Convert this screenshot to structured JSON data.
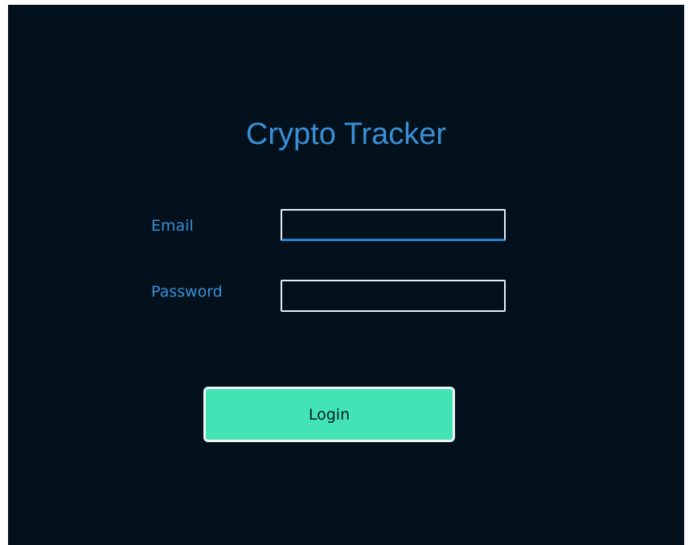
{
  "app": {
    "title": "Crypto Tracker"
  },
  "form": {
    "email_label": "Email",
    "email_value": "",
    "password_label": "Password",
    "password_value": "",
    "login_label": "Login"
  },
  "colors": {
    "background": "#02111c",
    "accent": "#3a8fd6",
    "button": "#42e3b4",
    "focus_underline": "#2a7fd4"
  }
}
